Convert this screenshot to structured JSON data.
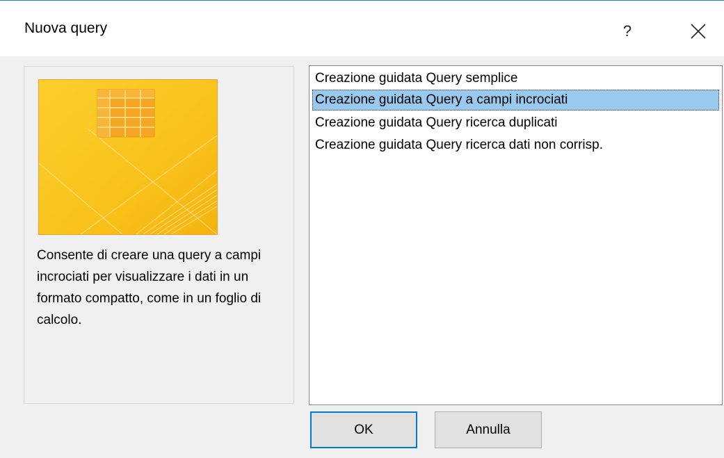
{
  "dialog": {
    "title": "Nuova query",
    "help_label": "?",
    "close_icon": "close-icon"
  },
  "preview": {
    "icon": "crosstab-table-icon",
    "colors": {
      "background": "#f8c21a",
      "accent": "#f5a623",
      "border": "#f0a030"
    }
  },
  "description": "Consente di creare una query a campi incrociati per visualizzare i dati in un formato compatto, come in un foglio di calcolo.",
  "wizards": [
    {
      "label": "Creazione guidata Query semplice",
      "selected": false
    },
    {
      "label": "Creazione guidata Query a campi incrociati",
      "selected": true
    },
    {
      "label": "Creazione guidata Query ricerca duplicati",
      "selected": false
    },
    {
      "label": "Creazione guidata Query ricerca dati non corrisp.",
      "selected": false
    }
  ],
  "buttons": {
    "ok": "OK",
    "cancel": "Annulla"
  },
  "colors": {
    "selection": "#99c9ef",
    "default_button_border": "#0078d7"
  }
}
